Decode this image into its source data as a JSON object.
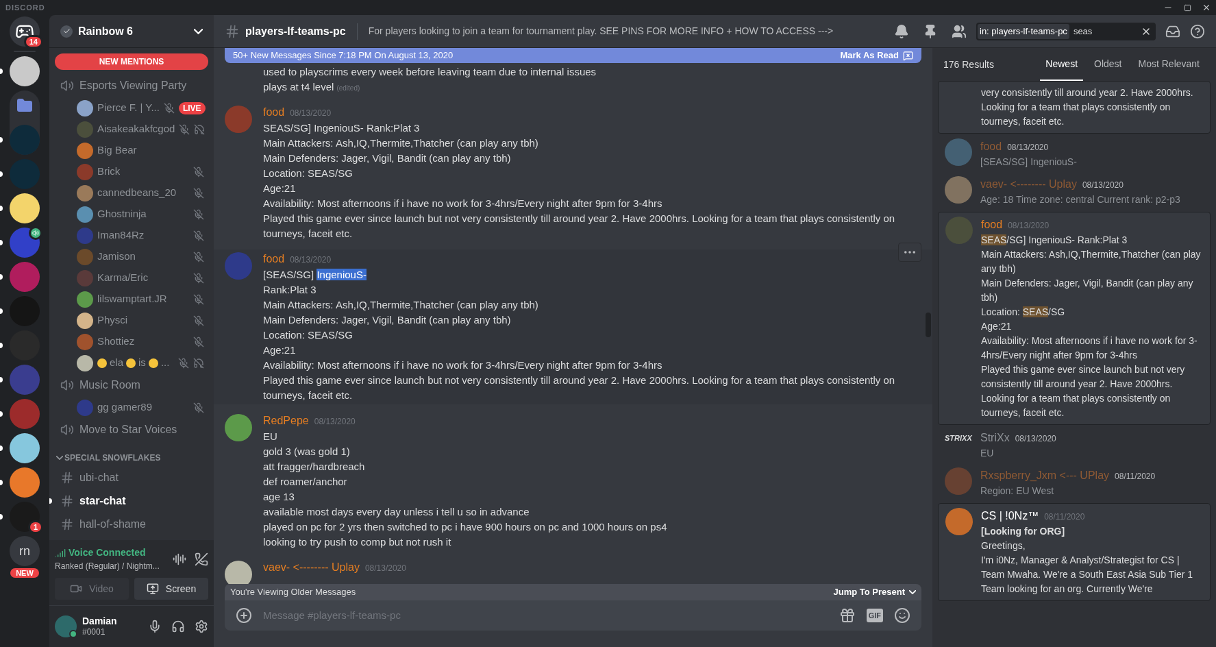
{
  "app": {
    "logo": "DISCORD"
  },
  "servers": [
    {
      "kind": "home",
      "badge": "14",
      "unread": false,
      "voice": false
    },
    {
      "kind": "server",
      "unread": true,
      "voice": false
    },
    {
      "kind": "folder",
      "unread": false,
      "voice": false,
      "children": [
        {
          "kind": "server",
          "unread": true,
          "voice": false
        }
      ]
    },
    {
      "kind": "server",
      "unread": true,
      "voice": false
    },
    {
      "kind": "server",
      "unread": true,
      "voice": false
    },
    {
      "kind": "server",
      "unread": true,
      "voice": true
    },
    {
      "kind": "server",
      "unread": true,
      "voice": false
    },
    {
      "kind": "server",
      "unread": true,
      "voice": false
    },
    {
      "kind": "server",
      "unread": true,
      "voice": false
    },
    {
      "kind": "server",
      "unread": true,
      "voice": false
    },
    {
      "kind": "server",
      "unread": true,
      "voice": false
    },
    {
      "kind": "server",
      "unread": true,
      "voice": false
    },
    {
      "kind": "server",
      "unread": true,
      "voice": false
    },
    {
      "kind": "server",
      "unread": true,
      "voice": false,
      "badge": "1"
    },
    {
      "kind": "text",
      "label": "rn",
      "mention": "NEW",
      "unread": false,
      "voice": false
    }
  ],
  "guild": {
    "name": "Rainbow 6",
    "verified": true,
    "new_mentions": "NEW MENTIONS"
  },
  "channels": [
    {
      "kind": "voice",
      "name": "Esports Viewing Party",
      "members": [
        {
          "name": "Pierce F. | Y...",
          "muted": true,
          "deafened": false,
          "live": "LIVE"
        },
        {
          "name": "Aisakeakakfcgod",
          "muted": true,
          "deafened": true
        },
        {
          "name": "Big Bear",
          "muted": false,
          "deafened": false
        },
        {
          "name": "Brick",
          "muted": true,
          "deafened": false
        },
        {
          "name": "cannedbeans_20",
          "muted": true,
          "deafened": false
        },
        {
          "name": "Ghostninja",
          "muted": true,
          "deafened": false
        },
        {
          "name": "Iman84Rz",
          "muted": true,
          "deafened": false
        },
        {
          "name": "Jamison",
          "muted": true,
          "deafened": false
        },
        {
          "name": "Karma/Eric",
          "muted": true,
          "deafened": false
        },
        {
          "name": "lilswamptart.JR",
          "muted": true,
          "deafened": false
        },
        {
          "name": "Physci",
          "muted": true,
          "deafened": false
        },
        {
          "name": "Shottiez",
          "muted": true,
          "deafened": false
        },
        {
          "name_parts": [
            {
              "kind": "emoji"
            },
            {
              "kind": "text",
              "text": "ela"
            },
            {
              "kind": "emoji"
            },
            {
              "kind": "text",
              "text": "is"
            },
            {
              "kind": "emoji"
            },
            {
              "kind": "text",
              "text": "..."
            }
          ],
          "muted": true,
          "deafened": true
        }
      ]
    },
    {
      "kind": "voice",
      "name": "Music Room",
      "members": [
        {
          "name": "gg gamer89",
          "muted": true,
          "deafened": false
        }
      ]
    },
    {
      "kind": "voice",
      "name": "Move to Star Voices"
    },
    {
      "kind": "category",
      "name": "SPECIAL SNOWFLAKES",
      "expanded": true,
      "children": [
        {
          "kind": "text",
          "name": "ubi-chat",
          "unread": false
        },
        {
          "kind": "text",
          "name": "star-chat",
          "unread": true
        },
        {
          "kind": "text",
          "name": "hall-of-shame",
          "unread": false
        }
      ]
    }
  ],
  "voice_status": {
    "title": "Voice Connected",
    "channel": "Ranked (Regular) / Nightm...",
    "buttons": [
      {
        "kind": "video",
        "label": "Video",
        "disabled": true
      },
      {
        "kind": "screen",
        "label": "Screen",
        "disabled": false
      }
    ]
  },
  "user": {
    "name": "Damian",
    "tag": "#0001",
    "online": true
  },
  "channel_header": {
    "name": "players-lf-teams-pc",
    "topic": "For players looking to join a team for tournament play. SEE PINS FOR MORE INFO + HOW TO ACCESS --->",
    "search": {
      "filter": "in: players-lf-teams-pc",
      "value": "seas"
    }
  },
  "new_messages_bar": {
    "text": "50+ New Messages Since 7:18 PM On August 13, 2020",
    "action": "Mark As Read"
  },
  "messages": [
    {
      "kind": "continuation",
      "hovered": false,
      "lines": [
        "used to playscrims every week before leaving team due to internal issues",
        "plays at t4 level"
      ],
      "edited": "(edited)"
    },
    {
      "kind": "message",
      "author": "food",
      "color": "#e67e22",
      "time": "08/13/2020",
      "hovered": false,
      "lines": [
        "SEAS/SG] IngeniouS- Rank:Plat 3",
        "Main Attackers: Ash,IQ,Thermite,Thatcher (can play any tbh)",
        "Main Defenders: Jager, Vigil, Bandit (can play any tbh)",
        "Location: SEAS/SG",
        "Age:21",
        "Availability: Most afternoons if i have no work for 3-4hrs/Every night after 9pm for 3-4hrs",
        "Played this game ever since launch but not very consistently till around year 2. Have 2000hrs. Looking for a team that plays consistently on tourneys, faceit etc."
      ]
    },
    {
      "kind": "message",
      "author": "food",
      "color": "#e67e22",
      "time": "08/13/2020",
      "hovered": true,
      "lines": [
        [
          {
            "text": "[SEAS/SG] ",
            "highlight": false
          },
          {
            "text": "IngeniouS-",
            "highlight": true
          }
        ],
        "Rank:Plat 3",
        "Main Attackers: Ash,IQ,Thermite,Thatcher (can play any tbh)",
        "Main Defenders: Jager, Vigil, Bandit (can play any tbh)",
        "Location: SEAS/SG",
        "Age:21",
        "Availability: Most afternoons if i have no work for 3-4hrs/Every night after 9pm for 3-4hrs",
        "Played this game ever since launch but not very consistently till around year 2. Have 2000hrs. Looking for a team that plays consistently on tourneys, faceit etc."
      ]
    },
    {
      "kind": "message",
      "author": "RedPepe",
      "color": "#e67e22",
      "time": "08/13/2020",
      "hovered": false,
      "lines": [
        "EU",
        "gold 3 (was gold 1)",
        "att fragger/hardbreach",
        "def roamer/anchor",
        "age 13",
        "available most days every day unless i tell u so in advance",
        "played on pc for 2 yrs then switched to pc i have 900 hours on pc and 1000 hours on ps4",
        "looking to try push to comp but not rush it"
      ]
    },
    {
      "kind": "message",
      "author": "vaev- <-------- Uplay",
      "color": "#e67e22",
      "time": "08/13/2020",
      "hovered": false
    }
  ],
  "older_bar": {
    "text": "You're Viewing Older Messages",
    "action": "Jump To Present"
  },
  "composer": {
    "placeholder": "Message #players-lf-teams-pc",
    "gif": "GIF"
  },
  "search_results": {
    "count": "176 Results",
    "tabs": [
      {
        "label": "Newest",
        "selected": true
      },
      {
        "label": "Oldest",
        "selected": false
      },
      {
        "label": "Most Relevant",
        "selected": false
      }
    ],
    "results": [
      {
        "kind": "hit",
        "lines": [
          "very consistently till around year 2. Have 2000hrs. Looking for a team that plays consistently on tourneys, faceit etc."
        ]
      },
      {
        "kind": "context",
        "author": "food",
        "color": "#8f5a34",
        "time": "08/13/2020",
        "lines": [
          "[SEAS/SG] IngeniouS-"
        ]
      },
      {
        "kind": "context",
        "author": "vaev- <-------- Uplay",
        "color": "#8f5a34",
        "time": "08/13/2020",
        "lines": [
          "Age: 18 Time zone: central Current rank: p2-p3"
        ]
      },
      {
        "kind": "hit",
        "author": "food",
        "color": "#e67e22",
        "time": "08/13/2020",
        "lines": [
          [
            {
              "text": "SEAS",
              "highlight": true
            },
            {
              "text": "/SG] IngeniouS- Rank:Plat 3",
              "highlight": false
            }
          ],
          "Main Attackers: Ash,IQ,Thermite,Thatcher (can play any tbh)",
          "Main Defenders: Jager, Vigil, Bandit (can play any tbh)",
          [
            {
              "text": "Location: ",
              "highlight": false
            },
            {
              "text": "SEAS",
              "highlight": true
            },
            {
              "text": "/SG",
              "highlight": false
            }
          ],
          "Age:21",
          "Availability: Most afternoons if i have no work for 3-4hrs/Every night after 9pm for 3-4hrs",
          "Played this game ever since launch but not very consistently till around year 2. Have 2000hrs. Looking for a team that plays consistently on tourneys, faceit etc."
        ]
      },
      {
        "kind": "context",
        "author": "StriXx",
        "avatar_text": "STRIXX",
        "color": "#8e9297",
        "time": "08/13/2020",
        "lines": [
          "EU"
        ]
      },
      {
        "kind": "context",
        "author": "Rxspberry_Jxm <--- UPlay",
        "color": "#8f5a34",
        "time": "08/11/2020",
        "lines": [
          "Region: EU West"
        ]
      },
      {
        "kind": "hit",
        "author": "CS | !0Nz™",
        "color": "#ffffff",
        "time": "08/11/2020",
        "lines": [
          "**[Looking for ORG]**",
          "Greetings,",
          "I'm i0Nz, Manager & Analyst/Strategist for CS | Team Mwaha. We're a South East Asia Sub Tier 1 Team looking for an org. Currently We're"
        ]
      }
    ]
  }
}
